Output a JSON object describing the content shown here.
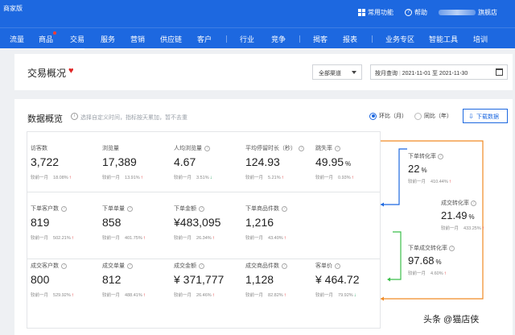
{
  "topbar": {
    "brand": "商家版",
    "common_functions": "常用功能",
    "help": "帮助",
    "shop_suffix": "旗舰店"
  },
  "nav": {
    "items": [
      "流量",
      "商品",
      "交易",
      "服务",
      "营销",
      "供应链",
      "客户",
      "行业",
      "竞争",
      "揭客",
      "报表",
      "业务专区",
      "智能工具",
      "培训"
    ],
    "active": "交易"
  },
  "header": {
    "title": "交易概况",
    "channel_select": "全部渠道",
    "date_label": "按月查询",
    "date_start": "2021-11-01",
    "date_sep": "至",
    "date_end": "2021-11-30"
  },
  "overview": {
    "title": "数据概览",
    "hint": "选择自定义时间，指标按天累加，暂不去重",
    "radio_mom": "环比（月）",
    "radio_yoy": "同比（年）",
    "download": "下载数据"
  },
  "compare_label": "较前一月",
  "metrics": [
    {
      "label": "访客数",
      "value": "3,722",
      "pct": "18.08%",
      "trend": "up",
      "help": false
    },
    {
      "label": "浏览量",
      "value": "17,389",
      "pct": "13.91%",
      "trend": "up",
      "help": false
    },
    {
      "label": "人均浏览量",
      "value": "4.67",
      "pct": "3.51%",
      "trend": "down",
      "help": true
    },
    {
      "label": "平均停留时长（秒）",
      "value": "124.93",
      "pct": "5.21%",
      "trend": "up",
      "help": true
    },
    {
      "label": "跳失率",
      "value": "49.95",
      "unit": "%",
      "pct": "0.93%",
      "trend": "up",
      "help": true
    },
    {
      "label": "下单客户数",
      "value": "819",
      "pct": "502.21%",
      "trend": "up",
      "help": true
    },
    {
      "label": "下单单量",
      "value": "858",
      "pct": "401.75%",
      "trend": "up",
      "help": true
    },
    {
      "label": "下单金额",
      "value": "¥483,095",
      "pct": "26.34%",
      "trend": "up",
      "help": true
    },
    {
      "label": "下单商品件数",
      "value": "1,216",
      "pct": "43.40%",
      "trend": "up",
      "help": true
    },
    {
      "label": "成交客户数",
      "value": "800",
      "pct": "529.92%",
      "trend": "up",
      "help": true
    },
    {
      "label": "成交单量",
      "value": "812",
      "pct": "488.41%",
      "trend": "up",
      "help": true
    },
    {
      "label": "成交金额",
      "value": "¥ 371,777",
      "pct": "26.46%",
      "trend": "up",
      "help": true
    },
    {
      "label": "成交商品件数",
      "value": "1,128",
      "pct": "82.82%",
      "trend": "up",
      "help": true
    },
    {
      "label": "客单价",
      "value": "¥ 464.72",
      "pct": "79.92%",
      "trend": "down",
      "help": true
    }
  ],
  "rates": [
    {
      "label": "下单转化率",
      "value": "22",
      "unit": "%",
      "pct": "410.44%",
      "trend": "up"
    },
    {
      "label": "成交转化率",
      "value": "21.49",
      "unit": "%",
      "pct": "433.25%",
      "trend": "up"
    },
    {
      "label": "下单成交转化率",
      "value": "97.68",
      "unit": "%",
      "pct": "4.60%",
      "trend": "up"
    }
  ],
  "colors": {
    "primary": "#1d68e0",
    "up": "#e02424",
    "down": "#20a05a",
    "connector_blue": "#1d68e0",
    "connector_orange": "#f08a24",
    "connector_green": "#3bbf4a"
  },
  "watermark": "头条 @猫店侠"
}
